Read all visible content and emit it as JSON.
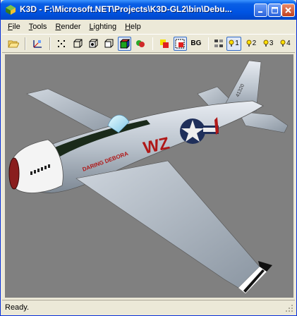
{
  "window": {
    "title": "K3D - F:\\Microsoft.NET\\Projects\\K3D-GL2\\bin\\Debu..."
  },
  "menu": {
    "items": [
      {
        "first": "F",
        "rest": "ile"
      },
      {
        "first": "T",
        "rest": "ools"
      },
      {
        "first": "R",
        "rest": "ender"
      },
      {
        "first": "L",
        "rest": "ighting"
      },
      {
        "first": "H",
        "rest": "elp"
      }
    ]
  },
  "toolbar": {
    "bg_label": "BG",
    "light_labels": [
      "1",
      "2",
      "3",
      "4"
    ]
  },
  "model": {
    "fuselage_text": "DARING DEBORA",
    "code": "WZ",
    "tail_number": "41320"
  },
  "status": {
    "text": "Ready."
  },
  "colors": {
    "title_blue": "#0054e3",
    "viewport_gray": "#808080",
    "window_bg": "#ece9d8"
  }
}
